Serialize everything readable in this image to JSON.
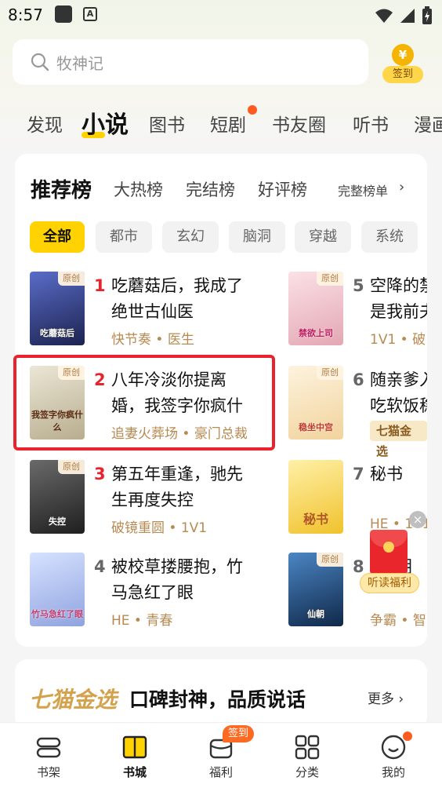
{
  "status_bar": {
    "time": "8:57",
    "notification_badge": "A"
  },
  "search": {
    "placeholder": "牧神记"
  },
  "signin": {
    "icon_symbol": "¥",
    "label": "签到"
  },
  "channel_tabs": [
    {
      "label": "发现",
      "active": false
    },
    {
      "label": "小说",
      "active": true
    },
    {
      "label": "图书",
      "active": false
    },
    {
      "label": "短剧",
      "active": false,
      "dot": true
    },
    {
      "label": "书友圈",
      "active": false
    },
    {
      "label": "听书",
      "active": false
    },
    {
      "label": "漫画",
      "active": false
    }
  ],
  "ranking": {
    "title": "推荐榜",
    "subtabs": [
      "大热榜",
      "完结榜",
      "好评榜"
    ],
    "full_list": "完整榜单",
    "chips": [
      {
        "label": "全部",
        "active": true
      },
      {
        "label": "都市",
        "active": false
      },
      {
        "label": "玄幻",
        "active": false
      },
      {
        "label": "脑洞",
        "active": false
      },
      {
        "label": "穿越",
        "active": false
      },
      {
        "label": "系统",
        "active": false
      }
    ],
    "original_badge": "原创",
    "left_column": [
      {
        "rank": "1",
        "title_line1": "吃蘑菇后，我成了",
        "title_line2": "绝世古仙医",
        "tags": "快节奏 • 医生",
        "cover_text": "吃蘑菇后",
        "cover_color": "#2f3f86",
        "rank_color": "#e8232d"
      },
      {
        "rank": "2",
        "title_line1": "八年冷淡你提离",
        "title_line2": "婚，我签字你疯什",
        "tags": "追妻火葬场 • 豪门总裁",
        "cover_text": "我签字你疯什么",
        "cover_color": "#d8d2bf",
        "rank_color": "#e8232d"
      },
      {
        "rank": "3",
        "title_line1": "第五年重逢，驰先",
        "title_line2": "生再度失控",
        "tags": "破镜重圆 • 1V1",
        "cover_text": "失控",
        "cover_color": "#3a3a3a",
        "rank_color": "#e8232d"
      },
      {
        "rank": "4",
        "title_line1": "被校草搂腰抱，竹",
        "title_line2": "马急红了眼",
        "tags": "HE • 青春",
        "cover_text": "竹马急红了眼",
        "cover_color": "#a9b9e8",
        "rank_color": "#666666"
      }
    ],
    "right_column": [
      {
        "rank": "5",
        "title_line1": "空降的禁",
        "title_line2": "是我前夫",
        "tags": "1V1 • 破",
        "cover_text": "禁欲上司",
        "cover_color": "#f2c6cf"
      },
      {
        "rank": "6",
        "title_line1": "随亲爹入",
        "title_line2": "吃软饭稳",
        "badge": "七猫金选",
        "cover_text": "稳坐中宫",
        "cover_color": "#f6e7c9"
      },
      {
        "rank": "7",
        "title_line1": "秘书",
        "title_line2": "",
        "tags": "HE • 1V1",
        "cover_text": "秘书",
        "cover_color": "#f6d76a"
      },
      {
        "rank": "8",
        "title_line1": "仙朝",
        "title_line2": "",
        "tags": "争霸 • 智",
        "cover_text": "仙朝",
        "cover_color": "#2b5a8a"
      }
    ]
  },
  "floating": {
    "label": "听读福利",
    "close_symbol": "×"
  },
  "gold_card": {
    "brand": "七猫金选",
    "slogan": "口碑封神，品质说话",
    "more": "更多"
  },
  "bottom_nav": [
    {
      "label": "书架",
      "icon": "bookshelf-icon",
      "active": false
    },
    {
      "label": "书城",
      "icon": "bookstore-icon",
      "active": true
    },
    {
      "label": "福利",
      "icon": "welfare-icon",
      "active": false,
      "badge": "签到"
    },
    {
      "label": "分类",
      "icon": "category-icon",
      "active": false
    },
    {
      "label": "我的",
      "icon": "profile-icon",
      "active": false,
      "dot": true
    }
  ]
}
